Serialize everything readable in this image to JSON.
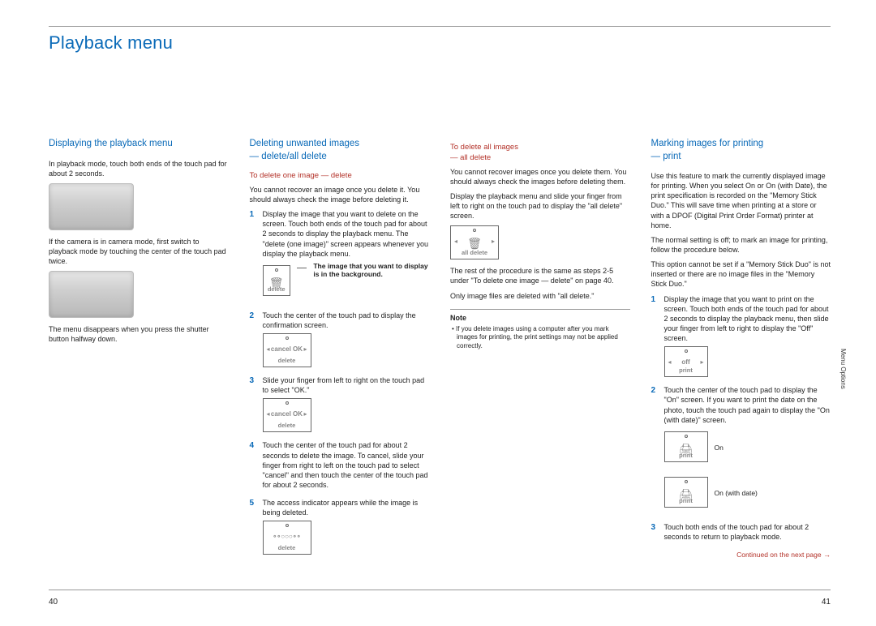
{
  "chapter_title": "Playback menu",
  "page_left": "40",
  "page_right": "41",
  "side_tab": "Menu Options",
  "continued": "Continued on the next page",
  "continued_arrow": "→",
  "col1": {
    "h1": "Displaying the playback menu",
    "p1": "In playback mode, touch both ends of the touch pad for about 2 seconds.",
    "p2": "If the camera is in camera mode, first switch to playback mode by touching the center of the touch pad twice.",
    "p3": "The menu disappears when you press the shutter button halfway down."
  },
  "col2": {
    "h1a": "Deleting unwanted images",
    "h1b": "— delete/all delete",
    "h2": "To delete one image — delete",
    "intro": "You cannot recover an image once you delete it. You should always check the image before deleting it.",
    "s1": "Display the image that you want to delete on the screen. Touch both ends of the touch pad for about 2 seconds to display the playback menu. The \"delete (one image)\" screen appears whenever you display the playback menu.",
    "callout": "The image that you want to display is in the background.",
    "s2": "Touch the center of the touch pad to display the confirmation screen.",
    "s3": "Slide your finger from left to right on the touch pad to select \"OK.\"",
    "s4": "Touch the center of the touch pad for about 2 seconds to delete the image. To cancel, slide your finger from right to left on the touch pad to select \"cancel\" and then touch the center of the touch pad for about 2 seconds.",
    "s5": "The access indicator appears while the image is being deleted.",
    "ic_delete": "delete",
    "ic_cancel_ok": "cancel OK"
  },
  "col3": {
    "h2a": "To delete all images",
    "h2b": "— all delete",
    "p1": "You cannot recover images once you delete them. You should always check the images before deleting them.",
    "p2": "Display the playback menu and slide your finger from left to right on the touch pad to display the \"all delete\" screen.",
    "p3": "The rest of the procedure is the same as steps 2-5 under \"To delete one image — delete\" on page 40.",
    "p4": "Only image files are deleted with \"all delete.\"",
    "note_title": "Note",
    "note_body": "• If you delete images using a computer after you mark images for printing, the print settings may not be applied correctly.",
    "ic_alldel": "all delete"
  },
  "col4": {
    "h1a": "Marking images for printing",
    "h1b": "— print",
    "p1": "Use this feature to mark the currently displayed image for printing. When you select On or On (with Date), the print specification is recorded on the \"Memory Stick Duo.\" This will save time when printing at a store or with a DPOF (Digital Print Order Format) printer at home.",
    "p2": "The normal setting is off; to mark an image for printing, follow the procedure below.",
    "p3": "This option cannot be set if a \"Memory Stick Duo\" is not inserted or there are no image files in the \"Memory Stick Duo.\"",
    "s1": "Display the image that you want to print on the screen. Touch both ends of the touch pad for about 2 seconds to display the playback menu, then slide your finger from left to right to display the \"Off\" screen.",
    "s2": "Touch the center of the touch pad to display the \"On\" screen. If you want to print the date on the photo, touch the touch pad again to display the \"On (with date)\" screen.",
    "s3": "Touch both ends of the touch pad for about 2 seconds to return to playback mode.",
    "lbl_on": "On",
    "lbl_on_date": "On (with date)",
    "ic_print": "print",
    "ic_off": "off"
  }
}
